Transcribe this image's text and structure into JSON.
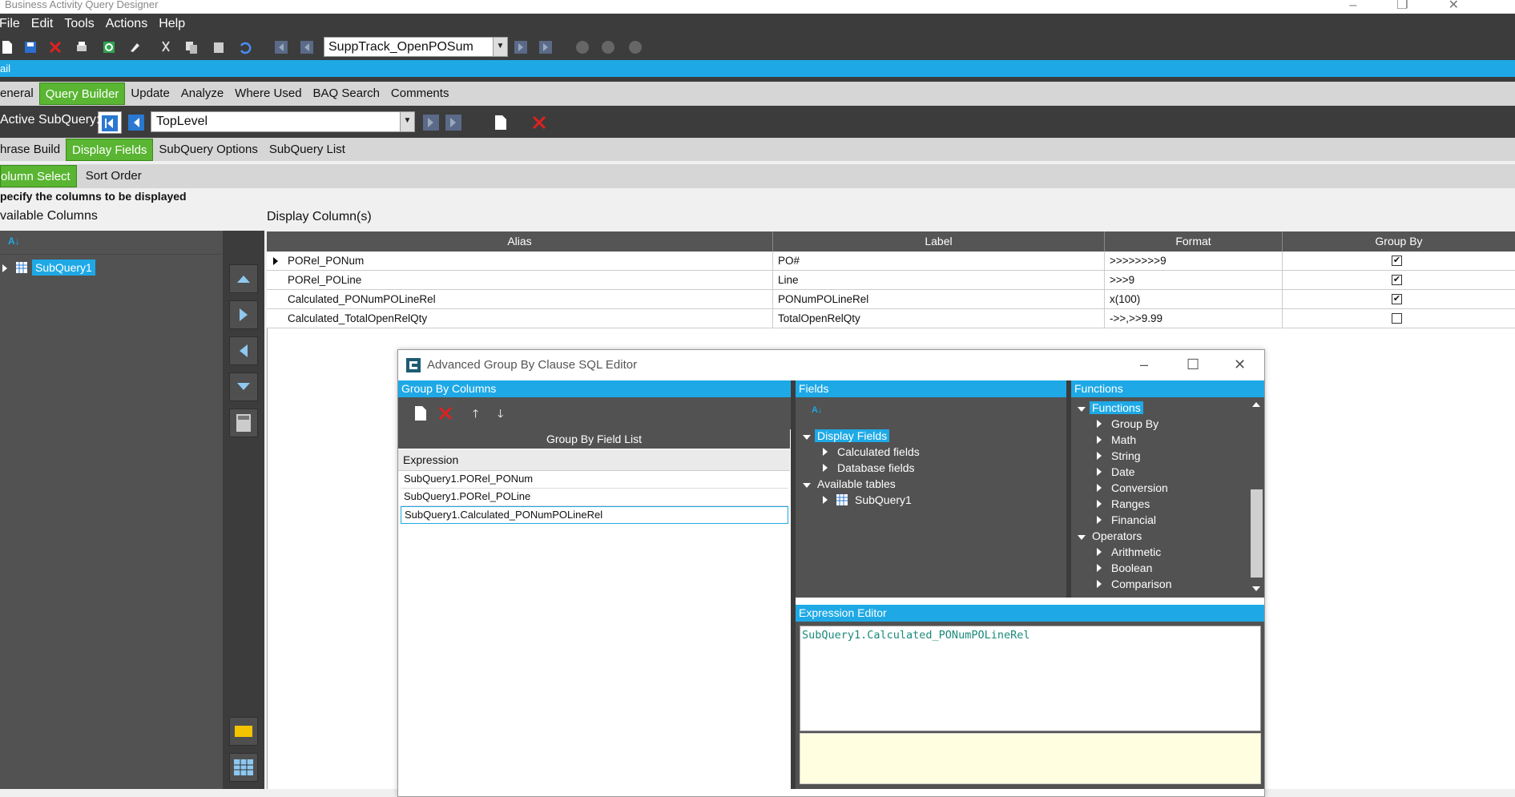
{
  "window": {
    "title": "Business Activity Query Designer"
  },
  "menu": [
    "File",
    "Edit",
    "Tools",
    "Actions",
    "Help"
  ],
  "toolbar": {
    "baq_id": "SuppTrack_OpenPOSum"
  },
  "detail_label": "ail",
  "main_tabs": [
    "eneral",
    "Query Builder",
    "Update",
    "Analyze",
    "Where Used",
    "BAQ Search",
    "Comments"
  ],
  "subquery": {
    "label": "Active SubQuery:",
    "value": "TopLevel"
  },
  "sub_tabs": [
    "hrase Build",
    "Display Fields",
    "SubQuery Options",
    "SubQuery List"
  ],
  "field_tabs": [
    "olumn Select",
    "Sort Order"
  ],
  "specify_text": "pecify the columns to be displayed",
  "available_columns": {
    "title": "vailable Columns",
    "node": "SubQuery1"
  },
  "display_columns": {
    "title": "Display Column(s)",
    "headers": [
      "Alias",
      "Label",
      "Format",
      "Group By"
    ],
    "rows": [
      {
        "alias": "PORel_PONum",
        "label": "PO#",
        "format": ">>>>>>>>9",
        "group_by": true
      },
      {
        "alias": "PORel_POLine",
        "label": "Line",
        "format": ">>>9",
        "group_by": true
      },
      {
        "alias": "Calculated_PONumPOLineRel",
        "label": "PONumPOLineRel",
        "format": "x(100)",
        "group_by": true
      },
      {
        "alias": "Calculated_TotalOpenRelQty",
        "label": "TotalOpenRelQty",
        "format": "->>,>>9.99",
        "group_by": false
      }
    ]
  },
  "dialog": {
    "title": "Advanced Group By Clause SQL Editor",
    "group_by_columns": {
      "header": "Group By Columns",
      "list_title": "Group By Field List",
      "column_header": "Expression",
      "expressions": [
        "SubQuery1.PORel_PONum",
        "SubQuery1.PORel_POLine",
        "SubQuery1.Calculated_PONumPOLineRel"
      ]
    },
    "fields": {
      "header": "Fields",
      "tree": {
        "display_fields": "Display Fields",
        "calculated": "Calculated fields",
        "database": "Database fields",
        "available_tables": "Available tables",
        "subquery": "SubQuery1"
      }
    },
    "functions": {
      "header": "Functions",
      "root": "Functions",
      "function_items": [
        "Group By",
        "Math",
        "String",
        "Date",
        "Conversion",
        "Ranges",
        "Financial"
      ],
      "operators": "Operators",
      "operator_items": [
        "Arithmetic",
        "Boolean",
        "Comparison"
      ]
    },
    "expression_editor": {
      "header": "Expression Editor",
      "text": "SubQuery1.Calculated_PONumPOLineRel"
    }
  },
  "colors": {
    "accent": "#1ea9e6",
    "active_tab": "#59b532",
    "dark": "#3c3c3c"
  }
}
